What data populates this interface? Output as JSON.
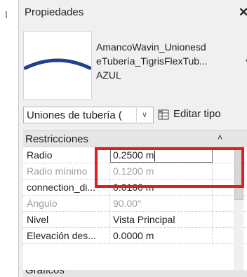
{
  "panel": {
    "title": "Propiedades",
    "close_glyph": "✕"
  },
  "type": {
    "line1": "AmancoWavin_Unionesd",
    "line2": "eTubería_TigrisFlexTub...",
    "line3": "AZUL",
    "preview_color": "#1f3f8f"
  },
  "selector": {
    "value": "Uniones de tubería (",
    "edit_type_label": "Editar tipo"
  },
  "sections": [
    {
      "label": "Restricciones",
      "toggle": "˄"
    },
    {
      "label": "Gráficos",
      "toggle": "˄"
    }
  ],
  "properties": [
    {
      "name": "Radio",
      "value": "0.2500 m",
      "editable": true,
      "muted": false
    },
    {
      "name": "Radio mínimo",
      "value": "0.1200 m",
      "editable": false,
      "muted": true
    },
    {
      "name": "connection_di...",
      "value": "0.0160 m",
      "editable": false,
      "muted": false
    },
    {
      "name": "Ángulo",
      "value": "90.00°",
      "editable": false,
      "muted": true
    },
    {
      "name": "Nivel",
      "value": "Vista Principal",
      "editable": false,
      "muted": false
    },
    {
      "name": "Elevación des...",
      "value": "0.0000 m",
      "editable": false,
      "muted": false
    }
  ],
  "highlight_color": "#e01e1e"
}
